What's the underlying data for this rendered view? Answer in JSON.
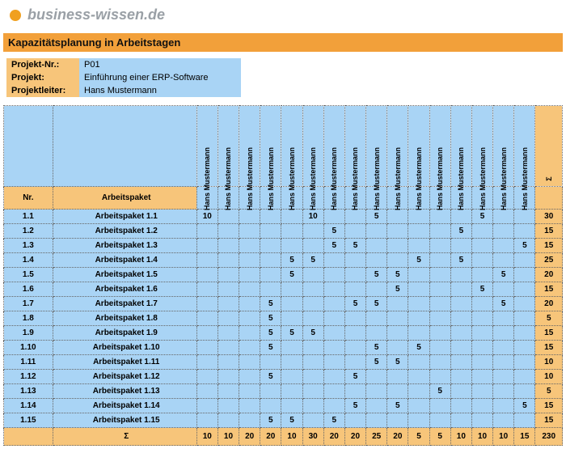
{
  "brand": "business-wissen.de",
  "title": "Kapazitätsplanung in Arbeitstagen",
  "project": {
    "l0": "Projekt-Nr.:",
    "v0": "P01",
    "l1": "Projekt:",
    "v1": "Einführung einer ERP-Software",
    "l2": "Projektleiter:",
    "v2": "Hans Mustermann"
  },
  "headers": {
    "nr": "Nr.",
    "ap": "Arbeitspaket",
    "sigma": "Σ"
  },
  "names": [
    "Hans Mustermann",
    "Hans Mustermann",
    "Hans Mustermann",
    "Hans Mustermann",
    "Hans Mustermann",
    "Hans Mustermann",
    "Hans Mustermann",
    "Hans Mustermann",
    "Hans Mustermann",
    "Hans Mustermann",
    "Hans Mustermann",
    "Hans Mustermann",
    "Hans Mustermann",
    "Hans Mustermann",
    "Hans Mustermann",
    "Hans Mustermann"
  ],
  "rows": [
    {
      "nr": "1.1",
      "ap": "Arbeitspaket 1.1",
      "c": [
        "10",
        "",
        "",
        "",
        "",
        "10",
        "",
        "",
        "5",
        "",
        "",
        "",
        "",
        "5",
        "",
        ""
      ],
      "sum": "30"
    },
    {
      "nr": "1.2",
      "ap": "Arbeitspaket 1.2",
      "c": [
        "",
        "",
        "",
        "",
        "",
        "",
        "5",
        "",
        "",
        "",
        "",
        "",
        "5",
        "",
        "",
        ""
      ],
      "sum": "15"
    },
    {
      "nr": "1.3",
      "ap": "Arbeitspaket 1.3",
      "c": [
        "",
        "",
        "",
        "",
        "",
        "",
        "5",
        "5",
        "",
        "",
        "",
        "",
        "",
        "",
        "",
        "5"
      ],
      "sum": "15"
    },
    {
      "nr": "1.4",
      "ap": "Arbeitspaket 1.4",
      "c": [
        "",
        "",
        "",
        "",
        "5",
        "5",
        "",
        "",
        "",
        "",
        "5",
        "",
        "5",
        "",
        "",
        ""
      ],
      "sum": "25"
    },
    {
      "nr": "1.5",
      "ap": "Arbeitspaket 1.5",
      "c": [
        "",
        "",
        "",
        "",
        "5",
        "",
        "",
        "",
        "5",
        "5",
        "",
        "",
        "",
        "",
        "5",
        ""
      ],
      "sum": "20"
    },
    {
      "nr": "1.6",
      "ap": "Arbeitspaket 1.6",
      "c": [
        "",
        "",
        "",
        "",
        "",
        "",
        "",
        "",
        "",
        "5",
        "",
        "",
        "",
        "5",
        "",
        ""
      ],
      "sum": "15"
    },
    {
      "nr": "1.7",
      "ap": "Arbeitspaket 1.7",
      "c": [
        "",
        "",
        "",
        "5",
        "",
        "",
        "",
        "5",
        "5",
        "",
        "",
        "",
        "",
        "",
        "5",
        ""
      ],
      "sum": "20"
    },
    {
      "nr": "1.8",
      "ap": "Arbeitspaket 1.8",
      "c": [
        "",
        "",
        "",
        "5",
        "",
        "",
        "",
        "",
        "",
        "",
        "",
        "",
        "",
        "",
        "",
        ""
      ],
      "sum": "5"
    },
    {
      "nr": "1.9",
      "ap": "Arbeitspaket 1.9",
      "c": [
        "",
        "",
        "",
        "5",
        "5",
        "5",
        "",
        "",
        "",
        "",
        "",
        "",
        "",
        "",
        "",
        ""
      ],
      "sum": "15"
    },
    {
      "nr": "1.10",
      "ap": "Arbeitspaket 1.10",
      "c": [
        "",
        "",
        "",
        "5",
        "",
        "",
        "",
        "",
        "5",
        "",
        "5",
        "",
        "",
        "",
        "",
        ""
      ],
      "sum": "15"
    },
    {
      "nr": "1.11",
      "ap": "Arbeitspaket 1.11",
      "c": [
        "",
        "",
        "",
        "",
        "",
        "",
        "",
        "",
        "5",
        "5",
        "",
        "",
        "",
        "",
        "",
        ""
      ],
      "sum": "10"
    },
    {
      "nr": "1.12",
      "ap": "Arbeitspaket 1.12",
      "c": [
        "",
        "",
        "",
        "5",
        "",
        "",
        "",
        "5",
        "",
        "",
        "",
        "",
        "",
        "",
        "",
        ""
      ],
      "sum": "10"
    },
    {
      "nr": "1.13",
      "ap": "Arbeitspaket 1.13",
      "c": [
        "",
        "",
        "",
        "",
        "",
        "",
        "",
        "",
        "",
        "",
        "",
        "5",
        "",
        "",
        "",
        ""
      ],
      "sum": "5"
    },
    {
      "nr": "1.14",
      "ap": "Arbeitspaket 1.14",
      "c": [
        "",
        "",
        "",
        "",
        "",
        "",
        "",
        "5",
        "",
        "5",
        "",
        "",
        "",
        "",
        "",
        "5"
      ],
      "sum": "15"
    },
    {
      "nr": "1.15",
      "ap": "Arbeitspaket 1.15",
      "c": [
        "",
        "",
        "",
        "5",
        "5",
        "",
        "5",
        "",
        "",
        "",
        "",
        "",
        "",
        "",
        "",
        ""
      ],
      "sum": "15"
    }
  ],
  "col_sums": [
    "10",
    "10",
    "20",
    "20",
    "10",
    "30",
    "20",
    "20",
    "25",
    "20",
    "5",
    "5",
    "10",
    "10",
    "10",
    "15"
  ],
  "grand_total": "230"
}
